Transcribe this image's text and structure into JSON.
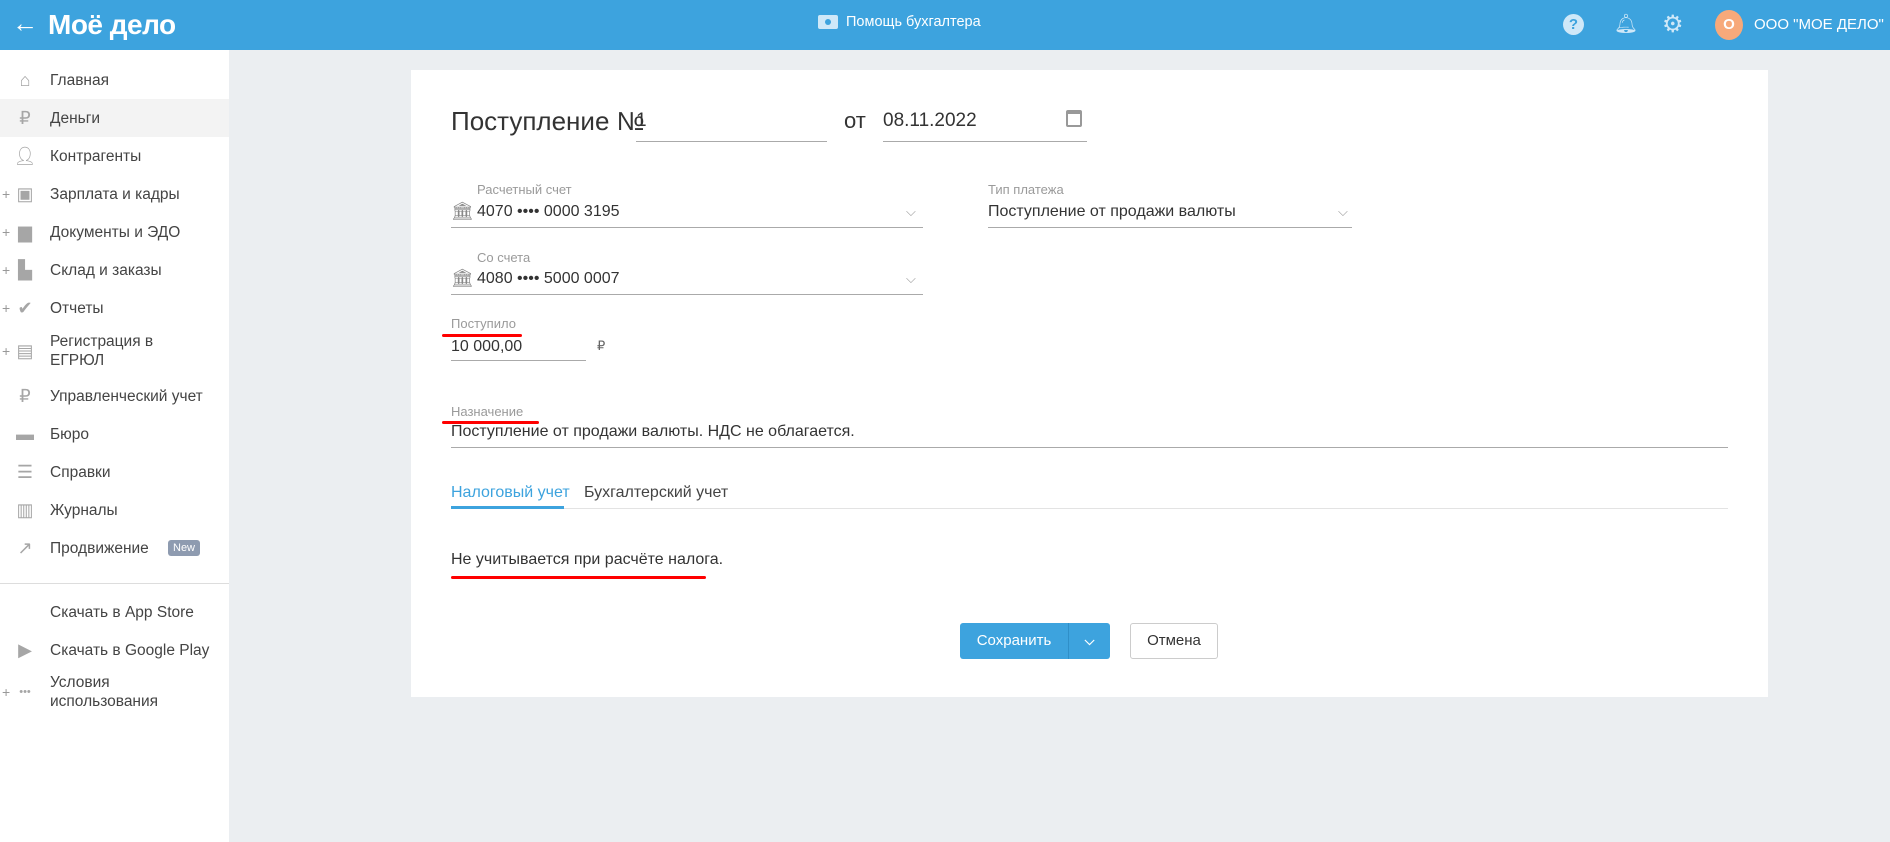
{
  "header": {
    "logo": "Моё дело",
    "help_center": "Помощь бухгалтера",
    "avatar_letter": "О",
    "company": "ООО \"МОЕ ДЕЛО\""
  },
  "sidebar": {
    "items": [
      {
        "label": "Главная",
        "icon": "home-icon",
        "plus": false
      },
      {
        "label": "Деньги",
        "icon": "money-icon",
        "plus": false,
        "active": true
      },
      {
        "label": "Контрагенты",
        "icon": "contractor-icon",
        "plus": false
      },
      {
        "label": "Зарплата и кадры",
        "icon": "wallet-icon",
        "plus": true
      },
      {
        "label": "Документы и ЭДО",
        "icon": "folder-icon",
        "plus": true
      },
      {
        "label": "Склад и заказы",
        "icon": "warehouse-icon",
        "plus": true
      },
      {
        "label": "Отчеты",
        "icon": "report-icon",
        "plus": true
      },
      {
        "label": "Регистрация в ЕГРЮЛ",
        "icon": "registration-icon",
        "plus": true
      },
      {
        "label": "Управленческий учет",
        "icon": "management-icon",
        "plus": false
      },
      {
        "label": "Бюро",
        "icon": "briefcase-icon",
        "plus": false
      },
      {
        "label": "Справки",
        "icon": "reference-icon",
        "plus": false
      },
      {
        "label": "Журналы",
        "icon": "journal-icon",
        "plus": false
      },
      {
        "label": "Продвижение",
        "icon": "chart-icon",
        "plus": false,
        "badge": "New"
      }
    ],
    "bottom": [
      {
        "label": "Скачать в App Store",
        "icon": "apple-icon"
      },
      {
        "label": "Скачать в Google Play",
        "icon": "google-play-icon"
      },
      {
        "label": "Условия использования",
        "icon": "more-icon"
      }
    ]
  },
  "form": {
    "title": "Поступление №",
    "number": "1",
    "date_prefix": "от",
    "date": "08.11.2022",
    "account_label": "Расчетный счет",
    "account_value": "4070 •••• 0000 3195",
    "payment_type_label": "Тип платежа",
    "payment_type_value": "Поступление от продажи валюты",
    "from_account_label": "Со счета",
    "from_account_value": "4080 •••• 5000 0007",
    "amount_label": "Поступило",
    "amount_value": "10 000,00",
    "currency": "₽",
    "purpose_label": "Назначение",
    "purpose_value": "Поступление от продажи валюты. НДС не облагается.",
    "tabs": [
      {
        "label": "Налоговый учет",
        "active": true
      },
      {
        "label": "Бухгалтерский учет",
        "active": false
      }
    ],
    "tax_note": "Не учитывается при расчёте налога.",
    "save_label": "Сохранить",
    "cancel_label": "Отмена"
  },
  "colors": {
    "header": "#3da3de",
    "accent": "#3da3de",
    "annotation": "#ff0000",
    "avatar": "#f7a97a"
  }
}
